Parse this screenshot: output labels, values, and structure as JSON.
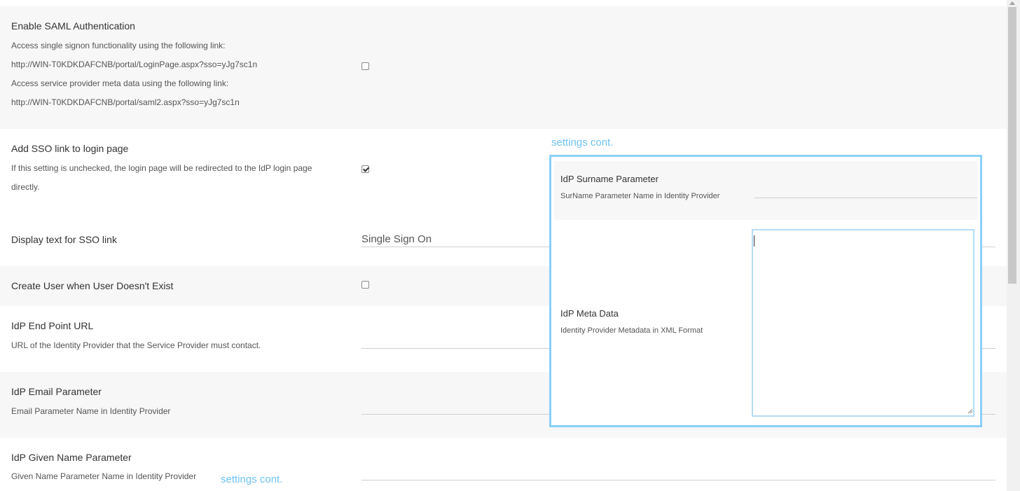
{
  "saml": {
    "title": "Enable SAML Authentication",
    "line1": "Access single signon functionality using the following link:",
    "link1": "http://WIN-T0KDKDAFCNB/portal/LoginPage.aspx?sso=yJg7sc1n",
    "line2": "Access service provider meta data using the following link:",
    "link2": "http://WIN-T0KDKDAFCNB/portal/saml2.aspx?sso=yJg7sc1n",
    "checked": false
  },
  "sso_link": {
    "title": "Add SSO link to login page",
    "desc_line1": "If this setting is unchecked, the login page will be redirected to the IdP login page",
    "desc_line2": "directly.",
    "checked": true
  },
  "display_text": {
    "title": "Display text for SSO link",
    "value": "Single Sign On"
  },
  "create_user": {
    "title": "Create User when User Doesn't Exist",
    "checked": false
  },
  "idp_endpoint": {
    "title": "IdP End Point URL",
    "desc": "URL of the Identity Provider that the Service Provider must contact.",
    "value": ""
  },
  "idp_email": {
    "title": "IdP Email Parameter",
    "desc": "Email Parameter Name in Identity Provider",
    "value": ""
  },
  "idp_given_name": {
    "title": "IdP Given Name Parameter",
    "desc": "Given Name Parameter Name in Identity Provider",
    "value": ""
  },
  "cont_label_top": "settings cont.",
  "cont_label_bottom": "settings cont.",
  "overlay": {
    "surname": {
      "title": "IdP Surname Parameter",
      "desc": "SurName Parameter Name in Identity Provider",
      "value": ""
    },
    "metadata": {
      "title": "IdP Meta Data",
      "desc": "Identity Provider Metadata in XML Format",
      "value": ""
    }
  },
  "colors": {
    "accent": "#6ec3f4",
    "overlay_border": "#8ad0f8",
    "row_shade": "#f7f7f7"
  }
}
